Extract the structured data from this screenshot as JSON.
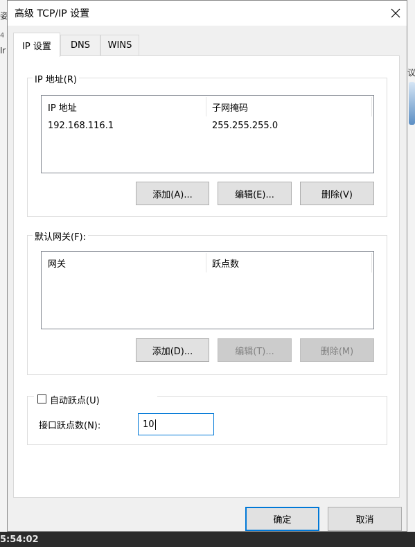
{
  "background": {
    "left_texts": [
      "姿",
      "4",
      "Ir"
    ],
    "right_text": "议",
    "taskbar_time": "5:54:02"
  },
  "dialog": {
    "title": "高级 TCP/IP 设置",
    "tabs": [
      {
        "label": "IP 设置",
        "active": true
      },
      {
        "label": "DNS",
        "active": false
      },
      {
        "label": "WINS",
        "active": false
      }
    ],
    "ip_group": {
      "legend": "IP 地址(R)",
      "columns": [
        "IP 地址",
        "子网掩码"
      ],
      "rows": [
        [
          "192.168.116.1",
          "255.255.255.0"
        ]
      ],
      "buttons": {
        "add": "添加(A)...",
        "edit": "编辑(E)...",
        "remove": "删除(V)"
      }
    },
    "gateway_group": {
      "legend": "默认网关(F):",
      "columns": [
        "网关",
        "跃点数"
      ],
      "buttons": {
        "add": "添加(D)...",
        "edit": "编辑(T)...",
        "remove": "删除(M)"
      }
    },
    "metric_group": {
      "auto_label": "自动跃点(U)",
      "auto_checked": false,
      "interface_label": "接口跃点数(N):",
      "interface_value": "10"
    },
    "footer": {
      "ok": "确定",
      "cancel": "取消"
    }
  },
  "colors": {
    "accent": "#0078d7",
    "dialog_bg": "#f0f0f0",
    "disabled_bg": "#cccccc"
  }
}
